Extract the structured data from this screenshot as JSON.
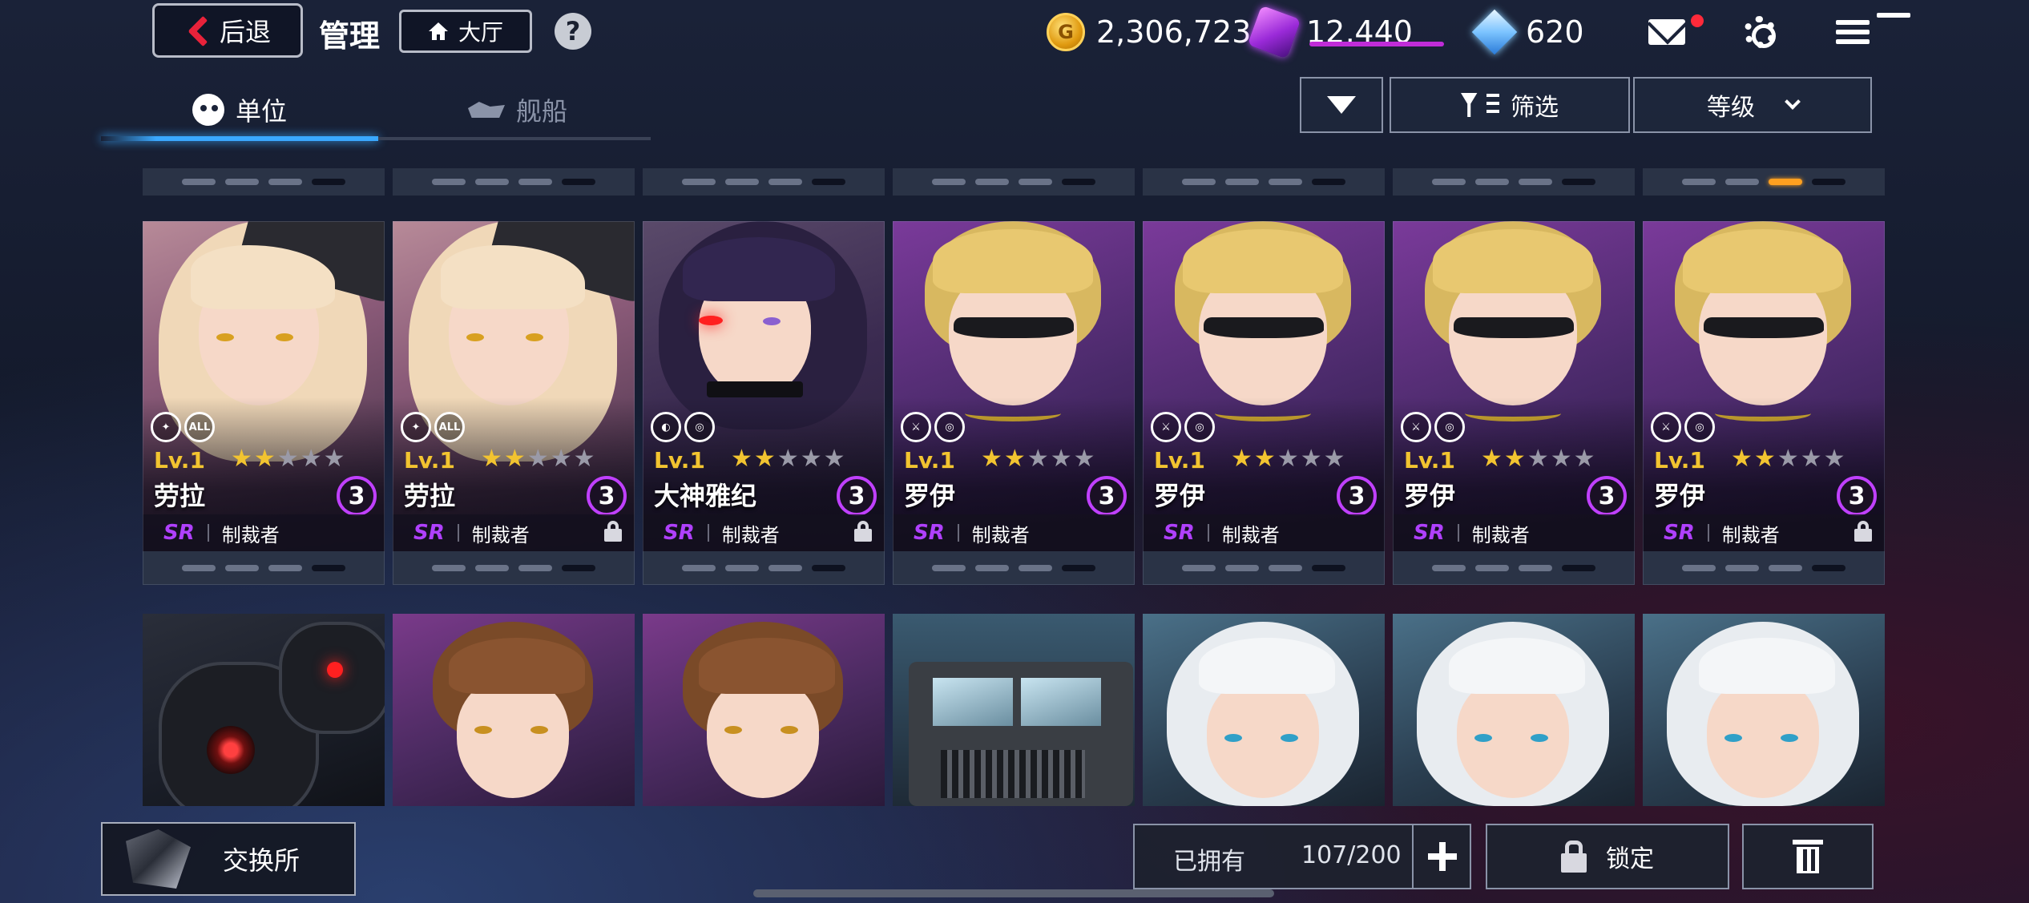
{
  "topbar": {
    "back_label": "后退",
    "title": "管理",
    "lobby_label": "大厅",
    "help_label": "?",
    "gold_amount": "2,306,723",
    "gem_amount": "12,440",
    "diamond_amount": "620",
    "gold_icon": "gold-coin-icon",
    "gem_icon": "purple-gem-icon",
    "diamond_icon": "blue-diamond-icon",
    "mail_has_notification": true,
    "menu_has_notification": true,
    "notification_color": "#ff2a3a"
  },
  "tabs": {
    "units_label": "单位",
    "ships_label": "舰船",
    "active_color": "#3aa8ff"
  },
  "sorting": {
    "filter_label": "筛选",
    "sort_by_label": "等级"
  },
  "units_row1": [
    {
      "level": "Lv.1",
      "stars_on": 2,
      "stars_total": 5,
      "name": "劳拉",
      "rank": "3",
      "rarity": "SR",
      "class": "制裁者",
      "skills": [
        "✦",
        "ALL"
      ],
      "locked": false
    },
    {
      "level": "Lv.1",
      "stars_on": 2,
      "stars_total": 5,
      "name": "劳拉",
      "rank": "3",
      "rarity": "SR",
      "class": "制裁者",
      "skills": [
        "✦",
        "ALL"
      ],
      "locked": true
    },
    {
      "level": "Lv.1",
      "stars_on": 2,
      "stars_total": 5,
      "name": "大神雅纪",
      "rank": "3",
      "rarity": "SR",
      "class": "制裁者",
      "skills": [
        "◐",
        "◎"
      ],
      "locked": true
    },
    {
      "level": "Lv.1",
      "stars_on": 2,
      "stars_total": 5,
      "name": "罗伊",
      "rank": "3",
      "rarity": "SR",
      "class": "制裁者",
      "skills": [
        "⚔",
        "◎"
      ],
      "locked": false
    },
    {
      "level": "Lv.1",
      "stars_on": 2,
      "stars_total": 5,
      "name": "罗伊",
      "rank": "3",
      "rarity": "SR",
      "class": "制裁者",
      "skills": [
        "⚔",
        "◎"
      ],
      "locked": false
    },
    {
      "level": "Lv.1",
      "stars_on": 2,
      "stars_total": 5,
      "name": "罗伊",
      "rank": "3",
      "rarity": "SR",
      "class": "制裁者",
      "skills": [
        "⚔",
        "◎"
      ],
      "locked": false
    },
    {
      "level": "Lv.1",
      "stars_on": 2,
      "stars_total": 5,
      "name": "罗伊",
      "rank": "3",
      "rarity": "SR",
      "class": "制裁者",
      "skills": [
        "⚔",
        "◎"
      ],
      "locked": true
    }
  ],
  "bottom": {
    "exchange_label": "交换所",
    "owned_label": "已拥有",
    "owned_count": "107/200",
    "lock_label": "锁定"
  },
  "colors": {
    "star": "#f2c430",
    "rank_ring": "#c040ff",
    "rarity_sr": "#b040ff"
  }
}
